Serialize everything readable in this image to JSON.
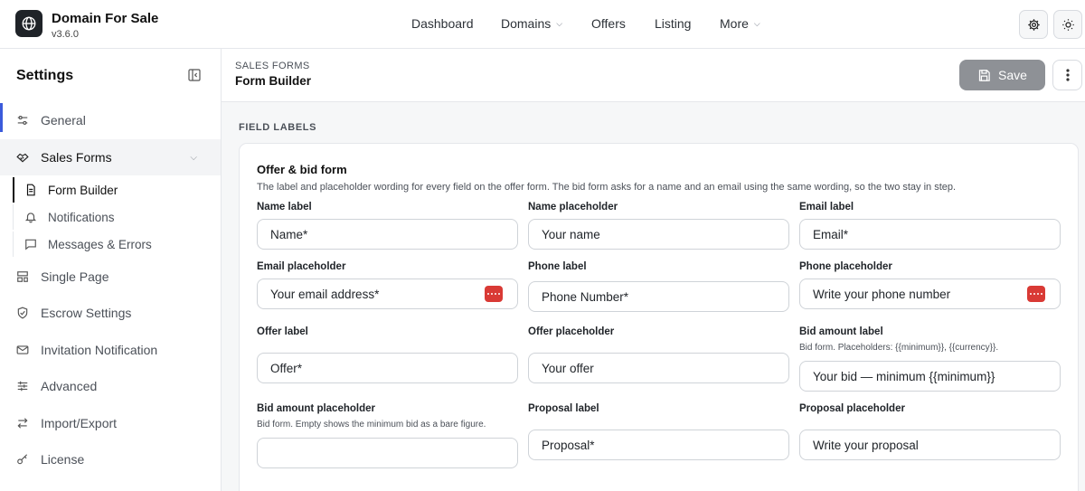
{
  "app": {
    "title": "Domain For Sale",
    "version": "v3.6.0"
  },
  "nav": [
    {
      "label": "Dashboard",
      "has_menu": false
    },
    {
      "label": "Domains",
      "has_menu": true
    },
    {
      "label": "Offers",
      "has_menu": false
    },
    {
      "label": "Listing",
      "has_menu": false
    },
    {
      "label": "More",
      "has_menu": true
    }
  ],
  "header_icons": [
    "gear-icon",
    "sun-icon"
  ],
  "sidebar": {
    "title": "Settings",
    "items": [
      {
        "label": "General",
        "icon": "sliders-icon"
      },
      {
        "label": "Sales Forms",
        "icon": "handshake-icon",
        "active": true
      },
      {
        "label": "Single Page",
        "icon": "layout-icon"
      },
      {
        "label": "Escrow Settings",
        "icon": "shield-icon"
      },
      {
        "label": "Invitation Notification",
        "icon": "mail-icon"
      },
      {
        "label": "Advanced",
        "icon": "adjust-icon"
      },
      {
        "label": "Import/Export",
        "icon": "swap-icon"
      },
      {
        "label": "License",
        "icon": "key-icon"
      }
    ],
    "sub_items": [
      {
        "label": "Form Builder",
        "icon": "document-icon",
        "active": true
      },
      {
        "label": "Notifications",
        "icon": "bell-icon"
      },
      {
        "label": "Messages & Errors",
        "icon": "message-icon"
      }
    ]
  },
  "main": {
    "breadcrumb": "SALES FORMS",
    "page_title": "Form Builder",
    "save_label": "Save",
    "section_label": "FIELD LABELS",
    "card": {
      "title": "Offer & bid form",
      "description": "The label and placeholder wording for every field on the offer form. The bid form asks for a name and an email using the same wording, so the two stay in step.",
      "fields": [
        {
          "label": "Name label",
          "help": "",
          "value": "Name*",
          "password_manager": false
        },
        {
          "label": "Name placeholder",
          "help": "",
          "value": "Your name",
          "password_manager": false
        },
        {
          "label": "Email label",
          "help": "",
          "value": "Email*",
          "password_manager": false
        },
        {
          "label": "Email placeholder",
          "help": "",
          "value": "Your email address*",
          "password_manager": true
        },
        {
          "label": "Phone label",
          "help": "",
          "value": "Phone Number*",
          "password_manager": false
        },
        {
          "label": "Phone placeholder",
          "help": "",
          "value": "Write your phone number",
          "password_manager": true
        },
        {
          "label": "Offer label",
          "help": "",
          "value": "Offer*",
          "password_manager": false
        },
        {
          "label": "Offer placeholder",
          "help": "",
          "value": "Your offer",
          "password_manager": false
        },
        {
          "label": "Bid amount label",
          "help": "Bid form. Placeholders: {{minimum}}, {{currency}}.",
          "value": "Your bid — minimum {{minimum}}",
          "password_manager": false
        },
        {
          "label": "Bid amount placeholder",
          "help": "Bid form. Empty shows the minimum bid as a bare figure.",
          "value": "",
          "password_manager": false
        },
        {
          "label": "Proposal label",
          "help": "",
          "value": "Proposal*",
          "password_manager": false
        },
        {
          "label": "Proposal placeholder",
          "help": "",
          "value": "Write your proposal",
          "password_manager": false
        }
      ]
    }
  },
  "colors": {
    "accent": "#3b5bdb",
    "save_button": "#8e9196",
    "password_manager_badge": "#d93a35"
  }
}
